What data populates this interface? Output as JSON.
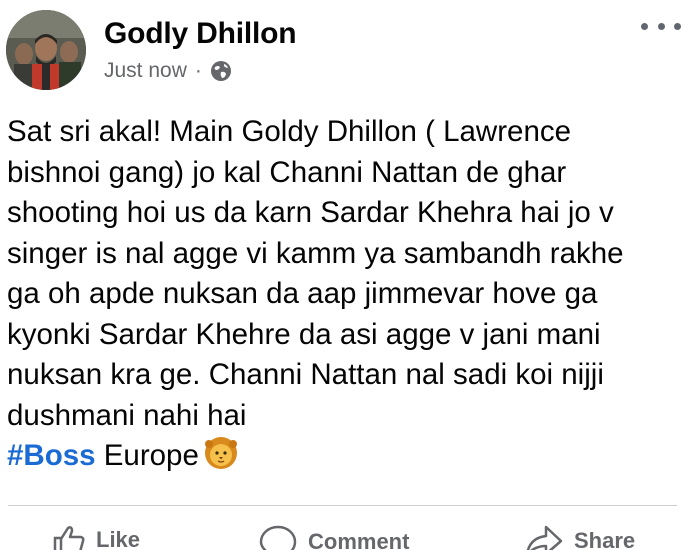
{
  "post": {
    "author": "Godly Dhillon",
    "timestamp": "Just now",
    "separator": "·",
    "privacy_icon": "globe-icon",
    "more_icon": "more-options-icon",
    "lines": [
      "Sat sri akal! Main Goldy Dhillon ( Lawrence",
      "bishnoi gang) jo kal Channi Nattan de ghar",
      "shooting hoi us da karn Sardar Khehra hai jo v",
      "singer is nal agge vi kamm ya sambandh rakhe",
      "ga oh apde nuksan da aap jimmevar hove ga",
      "kyonki Sardar Khehre da asi agge v jani mani",
      "nuksan kra ge. Channi Nattan nal sadi koi nijji",
      "dushmani nahi hai"
    ],
    "hashtag": "#Boss",
    "tag_suffix": " Europe",
    "emoji": "lion-face-emoji"
  },
  "actions": {
    "like_label": "Like",
    "comment_label": "Comment",
    "share_label": "Share"
  },
  "colors": {
    "hashtag": "#1b6bd4",
    "meta_text": "#65676b",
    "divider": "#ced0d4"
  }
}
